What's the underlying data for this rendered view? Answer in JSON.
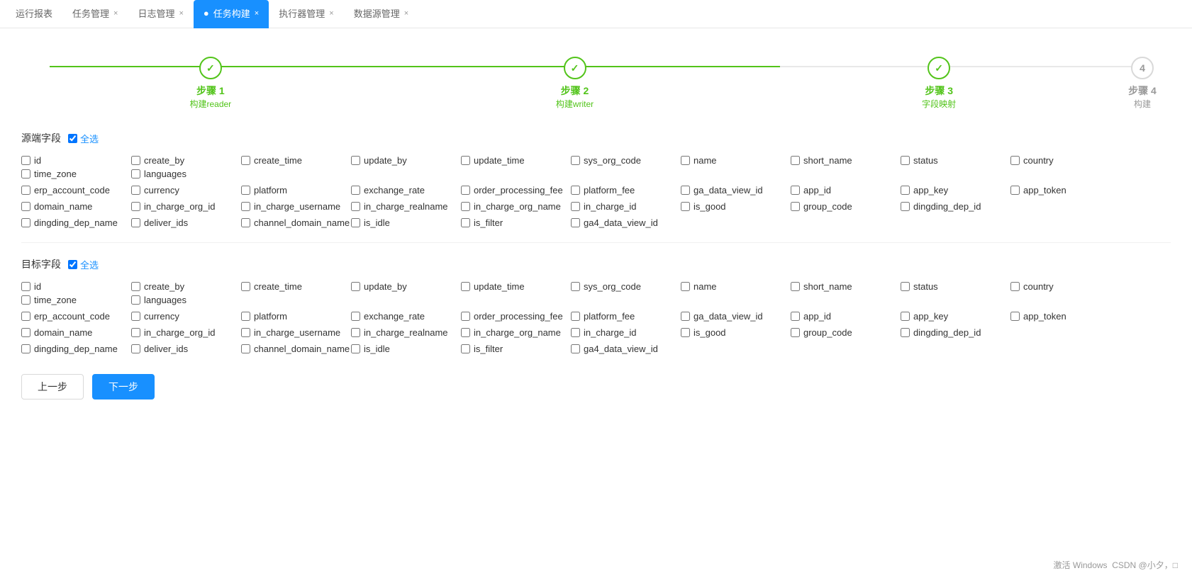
{
  "tabs": [
    {
      "label": "运行报表",
      "active": false,
      "closable": false
    },
    {
      "label": "任务管理",
      "active": false,
      "closable": true
    },
    {
      "label": "日志管理",
      "active": false,
      "closable": true
    },
    {
      "label": "任务构建",
      "active": true,
      "closable": true
    },
    {
      "label": "执行器管理",
      "active": false,
      "closable": true
    },
    {
      "label": "数据源管理",
      "active": false,
      "closable": true
    }
  ],
  "steps": [
    {
      "index": "1",
      "title": "步骤 1",
      "subtitle": "构建reader",
      "done": true
    },
    {
      "index": "2",
      "title": "步骤 2",
      "subtitle": "构建writer",
      "done": true
    },
    {
      "index": "3",
      "title": "步骤 3",
      "subtitle": "字段映射",
      "done": true
    },
    {
      "index": "4",
      "title": "步骤 4",
      "subtitle": "构建",
      "done": false
    }
  ],
  "source_section": {
    "label": "源端字段",
    "select_all": "全选"
  },
  "target_section": {
    "label": "目标字段",
    "select_all": "全选"
  },
  "fields_row1": [
    "id",
    "create_by",
    "create_time",
    "update_by",
    "update_time",
    "sys_org_code",
    "name",
    "short_name",
    "status",
    "country",
    "time_zone",
    "languages"
  ],
  "fields_row2": [
    "erp_account_code",
    "currency",
    "platform",
    "exchange_rate",
    "order_processing_fee",
    "platform_fee",
    "ga_data_view_id",
    "app_id",
    "app_key",
    "app_token"
  ],
  "fields_row3": [
    "domain_name",
    "in_charge_org_id",
    "in_charge_username",
    "in_charge_realname",
    "in_charge_org_name",
    "in_charge_id",
    "is_good",
    "group_code",
    "dingding_dep_id"
  ],
  "fields_row4": [
    "dingding_dep_name",
    "deliver_ids",
    "channel_domain_name",
    "is_idle",
    "is_filter",
    "ga4_data_view_id"
  ],
  "buttons": {
    "prev": "上一步",
    "next": "下一步"
  },
  "win_activate": "激活 Windows",
  "csdn_label": "CSDN @小夕，□"
}
